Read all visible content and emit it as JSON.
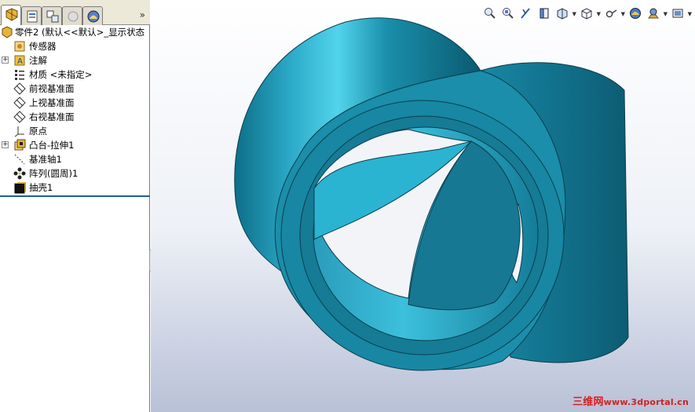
{
  "feature_tree": {
    "root": "零件2  (默认<<默认>_显示状态",
    "items": [
      {
        "label": "传感器",
        "icon": "sensor-icon",
        "expandable": false
      },
      {
        "label": "注解",
        "icon": "annotation-icon",
        "expandable": true
      },
      {
        "label": "材质 <未指定>",
        "icon": "material-icon",
        "expandable": false
      },
      {
        "label": "前视基准面",
        "icon": "plane-icon",
        "expandable": false
      },
      {
        "label": "上视基准面",
        "icon": "plane-icon",
        "expandable": false
      },
      {
        "label": "右视基准面",
        "icon": "plane-icon",
        "expandable": false
      },
      {
        "label": "原点",
        "icon": "origin-icon",
        "expandable": false
      },
      {
        "label": "凸台-拉伸1",
        "icon": "extrude-icon",
        "expandable": true
      },
      {
        "label": "基准轴1",
        "icon": "axis-icon",
        "expandable": false
      },
      {
        "label": "阵列(圆周)1",
        "icon": "circular-pattern-icon",
        "expandable": false
      },
      {
        "label": "抽壳1",
        "icon": "shell-icon",
        "expandable": false
      }
    ]
  },
  "panel_tabs": [
    "featuremanager-tab",
    "propertymanager-tab",
    "configurationmanager-tab",
    "dimxpert-tab",
    "display-manager-tab"
  ],
  "view_toolbar": [
    "zoom-to-fit-icon",
    "zoom-to-area-icon",
    "previous-view-icon",
    "section-view-icon",
    "view-orientation-icon",
    "display-style-icon",
    "hide-show-icon",
    "appearance-icon",
    "scene-icon",
    "view-settings-icon"
  ],
  "watermark": {
    "cn": "三维网",
    "url": "www.3dportal.cn"
  },
  "colors": {
    "model": "#1a8eaa",
    "model_dark": "#0a5a70",
    "model_light": "#4fd2ea",
    "selection_blue": "#1f5d9c",
    "watermark": "#d42020"
  }
}
